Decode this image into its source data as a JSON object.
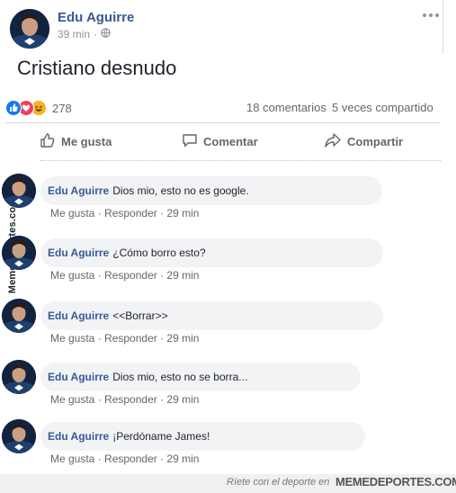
{
  "post": {
    "author": "Edu Aguirre",
    "time": "39 min",
    "text": "Cristiano desnudo",
    "reactions_count": "278",
    "comments_count": "18 comentarios",
    "shares_count": "5 veces compartido"
  },
  "actions": {
    "like": "Me gusta",
    "comment": "Comentar",
    "share": "Compartir"
  },
  "comments": [
    {
      "name": "Edu Aguirre",
      "text": "Dios mio, esto no es google.",
      "like": "Me gusta",
      "reply": "Responder",
      "time": "29 min"
    },
    {
      "name": "Edu Aguirre",
      "text": "¿Cómo borro esto?",
      "like": "Me gusta",
      "reply": "Responder",
      "time": "29 min"
    },
    {
      "name": "Edu Aguirre",
      "text": "<<Borrar>>",
      "like": "Me gusta",
      "reply": "Responder",
      "time": "29 min"
    },
    {
      "name": "Edu Aguirre",
      "text": "Dios mio, esto no se borra...",
      "like": "Me gusta",
      "reply": "Responder",
      "time": "29 min"
    },
    {
      "name": "Edu Aguirre",
      "text": "¡Perdóname James!",
      "like": "Me gusta",
      "reply": "Responder",
      "time": "29 min"
    }
  ],
  "watermark": {
    "side": "Memedeportes.com",
    "footer_prefix": "Ríete con el deporte en",
    "footer_brand": "MEMEDEPORTES.COM"
  },
  "colors": {
    "link_blue": "#385898",
    "bubble_bg": "#f2f3f5",
    "like_blue": "#1877f2",
    "love_red": "#f33e58",
    "haha_yellow": "#f7b125"
  }
}
